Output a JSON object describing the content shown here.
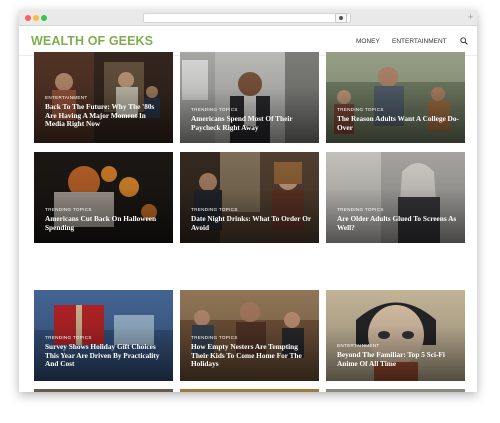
{
  "site": {
    "logo": "WEALTH OF GEEKS",
    "nav": [
      "MONEY",
      "ENTERTAINMENT"
    ]
  },
  "cards": [
    {
      "category": "ENTERTAINMENT",
      "title": "Back To The Future: Why The '80s Are Having A Major Moment In Media Right Now"
    },
    {
      "category": "TRENDING TOPICS",
      "title": "Americans Spend Most Of Their Paycheck Right Away"
    },
    {
      "category": "TRENDING TOPICS",
      "title": "The Reason Adults Want A College Do-Over"
    },
    {
      "category": "TRENDING TOPICS",
      "title": "Americans Cut Back On Halloween Spending"
    },
    {
      "category": "TRENDING TOPICS",
      "title": "Date Night Drinks: What To Order Or Avoid"
    },
    {
      "category": "TRENDING TOPICS",
      "title": "Are Older Adults Glued To Screens As Well?"
    },
    {
      "category": "TRENDING TOPICS",
      "title": "Survey Shows Holiday Gift Choices This Year Are Driven By Practicality And Cost"
    },
    {
      "category": "TRENDING TOPICS",
      "title": "How Empty Nesters Are Tempting Their Kids To Come Home For The Holidays"
    },
    {
      "category": "ENTERTAINMENT",
      "title": "Beyond The Familiar: Top 5 Sci-Fi Anime Of All Time"
    }
  ],
  "colors": {
    "brand": "#7fae4e",
    "chrome": "#e9e9e9"
  }
}
